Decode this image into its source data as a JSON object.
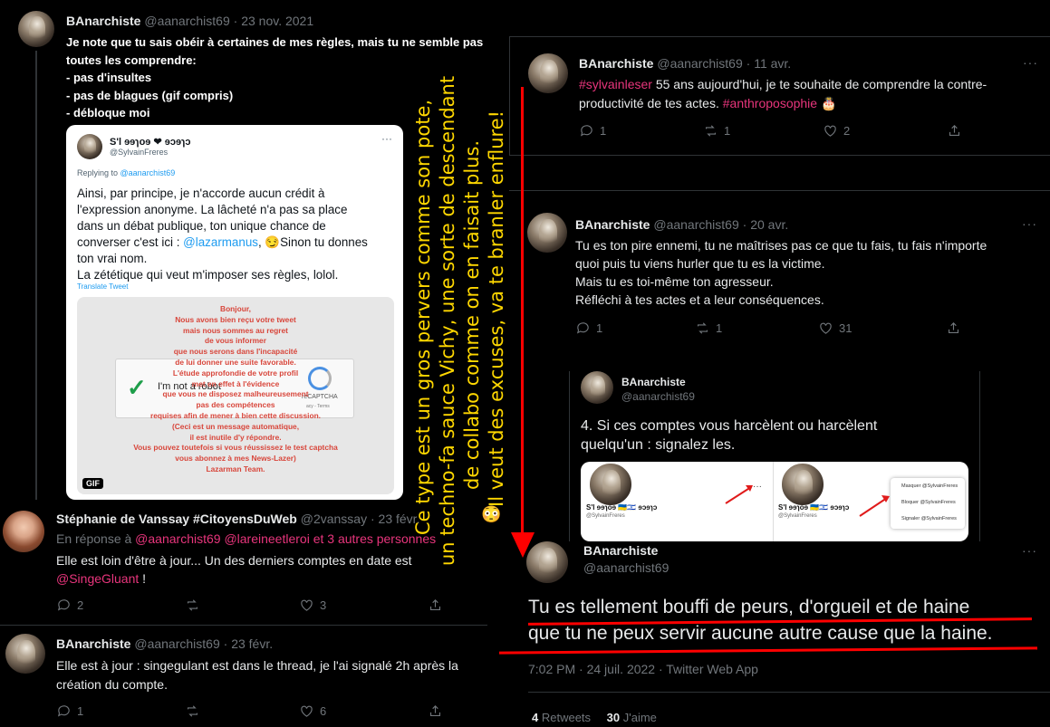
{
  "t1": {
    "name": "BAnarchiste",
    "handle": "@aanarchist69",
    "date": "· 23 nov. 2021",
    "lines": [
      "Je note que tu sais obéir à certaines de mes règles, mais tu ne semble pas",
      "toutes les comprendre:",
      "- pas d'insultes",
      "- pas de blagues (gif compris)",
      "- débloque moi"
    ]
  },
  "quoted": {
    "name": "S'l ɘɘɿoɘ ❤ ɘɔɘɿɔ",
    "handle": "@SylvainFreres",
    "replying_prefix": "Replying to ",
    "replying_handle": "@aanarchist69",
    "line1": "Ainsi, par principe, je n'accorde aucun crédit à",
    "line2": "l'expression anonyme. La lâcheté n'a pas sa place",
    "line3": "dans un débat publique, ton unique chance de",
    "line4_a": "converser c'est ici : ",
    "line4_mention": "@lazarmanus",
    "line4_b": ", 😏Sinon tu donnes",
    "line5": "ton vrai nom.",
    "line6": "La zététique qui veut m'imposer ses règles, lolol.",
    "translate": "Translate Tweet",
    "gif": "GIF"
  },
  "captcha": {
    "robot": "I'm not a robot",
    "brand": "reCAPTCHA",
    "terms": "acy - Terms",
    "msg": [
      "Bonjour,",
      "Nous avons bien reçu votre tweet",
      "mais nous sommes au regret",
      "de vous informer",
      "que nous serons dans l'incapacité",
      "de lui donner une suite favorable.",
      "L'étude approfondie de votre profil",
      "met en effet à l'évidence",
      "que vous ne disposez malheureusement",
      "pas des compétences",
      "requises afin de mener à bien cette discussion.",
      "(Ceci est un message automatique,",
      "il est inutile d'y répondre.",
      "Vous pouvez toutefois si vous réussissez le test captcha",
      "vous abonnez à mes News-Lazer)",
      "Lazarman Team."
    ]
  },
  "t2": {
    "name": "Stéphanie de Vanssay #CitoyensDuWeb",
    "handle": "@2vanssay",
    "date": "· 23 févr.",
    "reply_prefix": "En réponse à ",
    "reply_mentions": "@aanarchist69 @lareineetleroi  et 3 autres personnes",
    "text1": "Elle est loin d'être à jour... Un des derniers comptes en date est",
    "mention": "@SingeGluant",
    "text2": " !",
    "replies": "2",
    "likes": "3"
  },
  "t3": {
    "name": "BAnarchiste",
    "handle": "@aanarchist69",
    "date": "· 23 févr.",
    "text1": "Elle est à jour : singegulant est dans le thread, je l'ai signalé 2h après la",
    "text2": "création du compte.",
    "replies": "1",
    "likes": "6"
  },
  "t4": {
    "name": "BAnarchiste",
    "handle": "@aanarchist69",
    "date": "· 11 avr.",
    "hashtag1": "#sylvainleser",
    "text1": " 55 ans aujourd'hui, je te souhaite de comprendre la contre-",
    "text2": "productivité de tes actes. ",
    "hashtag2": "#anthroposophie",
    "emoji": " 🎂",
    "replies": "1",
    "retweets": "1",
    "likes": "2"
  },
  "t5": {
    "name": "BAnarchiste",
    "handle": "@aanarchist69",
    "date": "· 20 avr.",
    "lines": [
      "Tu es ton pire ennemi, tu ne maîtrises pas ce que tu fais, tu fais n'importe",
      "quoi puis tu viens hurler que tu es la victime.",
      "Mais tu es toi-même ton agresseur.",
      "Réfléchi à tes actes et a leur conséquences."
    ],
    "replies": "1",
    "retweets": "1",
    "likes": "31"
  },
  "t6": {
    "name": "BAnarchiste",
    "handle": "@aanarchist69",
    "line1": "4. Si ces comptes vous harcèlent ou harcèlent",
    "line2": "quelqu'un : signalez les.",
    "card_name": "S'l ɘɘɿoɘ 🇺🇦🇮🇱 ɘɔɘɿɔ",
    "card_handle": "@SylvainFreres",
    "menu": [
      "Masquer @SylvainFreres",
      "Bloquer @SylvainFreres",
      "Signaler @SylvainFreres"
    ]
  },
  "t7": {
    "name": "BAnarchiste",
    "handle": "@aanarchist69",
    "line1": "Tu es tellement bouffi de peurs, d'orgueil et de haine",
    "line2": "que tu ne peux servir aucune autre cause que la haine.",
    "timestamp": "7:02 PM · 24 juil. 2022 · Twitter Web App",
    "retweets_count": "4",
    "retweets_label": " Retweets",
    "likes_count": "30",
    "likes_label": " J'aime"
  },
  "overlay": {
    "lines": [
      "Ce type est un gros pervers comme son pote,",
      "un techno-fa sauce Vichy, une sorte de descendant",
      "de collabo comme on en faisait plus.",
      "Il veut des excuses, va te branler enflure!"
    ],
    "emoji": "😳"
  },
  "colors": {
    "accent": "#e8357c",
    "overlay": "#ffd700",
    "underline": "#ff0000"
  }
}
